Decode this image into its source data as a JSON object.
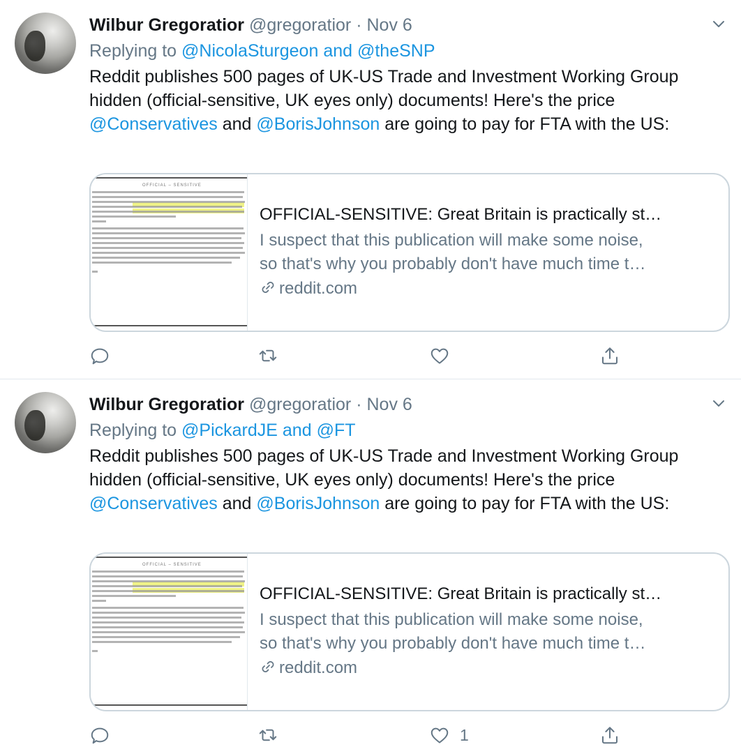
{
  "tweets": [
    {
      "name": "Wilbur Gregoratior",
      "handle": "@gregoratior",
      "separator": "·",
      "date": "Nov 6",
      "replying_prefix": "Replying to",
      "replying_first": "@NicolaSturgeon",
      "replying_and": "and",
      "replying_second": "@theSNP",
      "text_part1": "Reddit publishes 500 pages of UK-US Trade and Investment Working Group hidden (official-sensitive, UK eyes only) documents! Here's the price ",
      "mention1": "@Conservatives",
      "text_and": " and ",
      "mention2": "@BorisJohnson",
      "text_part2": " are going to pay for FTA with the US:",
      "card": {
        "title": "OFFICIAL-SENSITIVE: Great Britain is practically st…",
        "desc_line1": "I suspect that this publication will make some noise,",
        "desc_line2": "so that's why you probably don't have much time t…",
        "domain": "reddit.com",
        "thumb_label": "OFFICIAL – SENSITIVE"
      },
      "actions": {
        "reply_count": "",
        "retweet_count": "",
        "like_count": ""
      }
    },
    {
      "name": "Wilbur Gregoratior",
      "handle": "@gregoratior",
      "separator": "·",
      "date": "Nov 6",
      "replying_prefix": "Replying to",
      "replying_first": "@PickardJE",
      "replying_and": "and",
      "replying_second": "@FT",
      "text_part1": "Reddit publishes 500 pages of UK-US Trade and Investment Working Group hidden (official-sensitive, UK eyes only) documents! Here's the price ",
      "mention1": "@Conservatives",
      "text_and": " and ",
      "mention2": "@BorisJohnson",
      "text_part2": " are going to pay for FTA with the US:",
      "card": {
        "title": "OFFICIAL-SENSITIVE: Great Britain is practically st…",
        "desc_line1": "I suspect that this publication will make some noise,",
        "desc_line2": "so that's why you probably don't have much time t…",
        "domain": "reddit.com",
        "thumb_label": "OFFICIAL – SENSITIVE"
      },
      "actions": {
        "reply_count": "",
        "retweet_count": "",
        "like_count": "1"
      }
    }
  ],
  "colors": {
    "accent": "#1b95e0",
    "secondary_text": "#657786",
    "text": "#14171a",
    "border": "#ccd6dd"
  },
  "icons": [
    "avatar",
    "chevron-down-icon",
    "link-icon",
    "reply-icon",
    "retweet-icon",
    "like-icon",
    "share-icon"
  ]
}
